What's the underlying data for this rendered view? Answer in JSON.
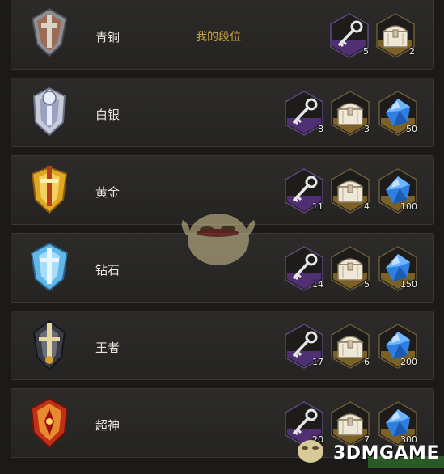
{
  "my_rank_label": "我的段位",
  "colors": {
    "key_hex": "#7b3fc0",
    "chest_hex": "#c89a30",
    "gem_hex": "#c89a30",
    "my_rank": "#c9a040"
  },
  "tiers": [
    {
      "name": "青铜",
      "emblem": "bronze-emblem-icon",
      "rewards": {
        "keys": "5",
        "chests": "2"
      }
    },
    {
      "name": "白银",
      "emblem": "silver-emblem-icon",
      "rewards": {
        "keys": "8",
        "chests": "3",
        "gems": "50"
      }
    },
    {
      "name": "黄金",
      "emblem": "gold-emblem-icon",
      "rewards": {
        "keys": "11",
        "chests": "4",
        "gems": "100"
      }
    },
    {
      "name": "钻石",
      "emblem": "diamond-emblem-icon",
      "rewards": {
        "keys": "14",
        "chests": "5",
        "gems": "150"
      }
    },
    {
      "name": "王者",
      "emblem": "king-emblem-icon",
      "rewards": {
        "keys": "17",
        "chests": "6",
        "gems": "200"
      }
    },
    {
      "name": "超神",
      "emblem": "godlike-emblem-icon",
      "rewards": {
        "keys": "20",
        "chests": "7",
        "gems": "300"
      }
    }
  ],
  "watermark_logo": "3DMGAME"
}
